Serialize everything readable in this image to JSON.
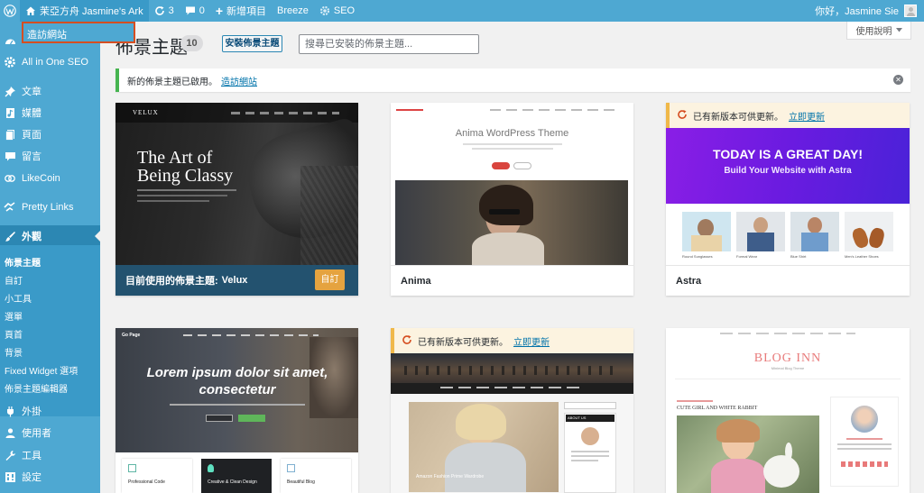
{
  "admin_bar": {
    "site_name": "茉亞方舟 Jasmine's Ark",
    "updates_count": "3",
    "comments_count": "0",
    "new_label": "新增項目",
    "breeze_label": "Breeze",
    "seo_label": "SEO",
    "greeting": "你好，Jasmine Sie",
    "dropdown_visit": "造訪網站"
  },
  "sidebar": {
    "items": [
      {
        "label": "",
        "icon": "dashboard-icon"
      },
      {
        "label": "All in One SEO",
        "icon": "gear-icon"
      },
      {
        "label": "文章",
        "icon": "pin-icon"
      },
      {
        "label": "媒體",
        "icon": "media-icon"
      },
      {
        "label": "頁面",
        "icon": "page-icon"
      },
      {
        "label": "留言",
        "icon": "comment-icon"
      },
      {
        "label": "LikeCoin",
        "icon": "likecoin-icon"
      },
      {
        "label": "Pretty Links",
        "icon": "link-icon"
      },
      {
        "label": "外觀",
        "icon": "brush-icon"
      },
      {
        "label": "外掛",
        "icon": "plugin-icon"
      },
      {
        "label": "使用者",
        "icon": "user-icon"
      },
      {
        "label": "工具",
        "icon": "wrench-icon"
      },
      {
        "label": "設定",
        "icon": "settings-icon"
      }
    ],
    "submenu": [
      "佈景主題",
      "自訂",
      "小工具",
      "選單",
      "頁首",
      "背景",
      "Fixed Widget 選項",
      "佈景主題編輯器"
    ]
  },
  "header": {
    "title": "佈景主題",
    "count": "10",
    "install_button": "安裝佈景主題",
    "search_placeholder": "搜尋已安裝的佈景主題...",
    "help_label": "使用說明"
  },
  "notice": {
    "text": "新的佈景主題已啟用。",
    "link": "造訪網站"
  },
  "themes": [
    {
      "name": "Velux",
      "active_prefix": "目前使用的佈景主題:",
      "customize_label": "自訂",
      "preview_brand": "VELUX",
      "preview_headline_1": "The Art of",
      "preview_headline_2": "Being Classy"
    },
    {
      "name": "Anima",
      "preview_title": "Anima WordPress Theme"
    },
    {
      "name": "Astra",
      "update_text": "已有新版本可供更新。",
      "update_link": "立即更新",
      "preview_headline": "TODAY IS A GREAT DAY!",
      "preview_sub": "Build Your Website with Astra",
      "products": [
        "Round Sunglasses",
        "Formal Wear",
        "Blue Shirt",
        "Men's Leather Shoes"
      ]
    },
    {
      "name": "",
      "preview_brand": "Go Page",
      "preview_headline": "Lorem ipsum dolor sit amet, consectetur",
      "features": [
        "Professional Code",
        "Creative & Clean Design",
        "Beautiful Blog"
      ]
    },
    {
      "name": "",
      "update_text": "已有新版本可供更新。",
      "update_link": "立即更新",
      "preview_caption": "Amazon Fashion Prime Wardrobe",
      "about_label": "ABOUT US"
    },
    {
      "name": "",
      "preview_title": "BLOG INN",
      "preview_subtitle": "Minimal Blog Theme",
      "post_title": "CUTE GIRL AND WHITE RABBIT"
    }
  ],
  "colors": {
    "adminbar": "#4ea8d2",
    "sidebar_current": "#2c87b3",
    "notice_success": "#46b450",
    "update_border": "#f0b849",
    "customize_button": "#e5a33f",
    "astra_purple": "#6a1be0"
  }
}
